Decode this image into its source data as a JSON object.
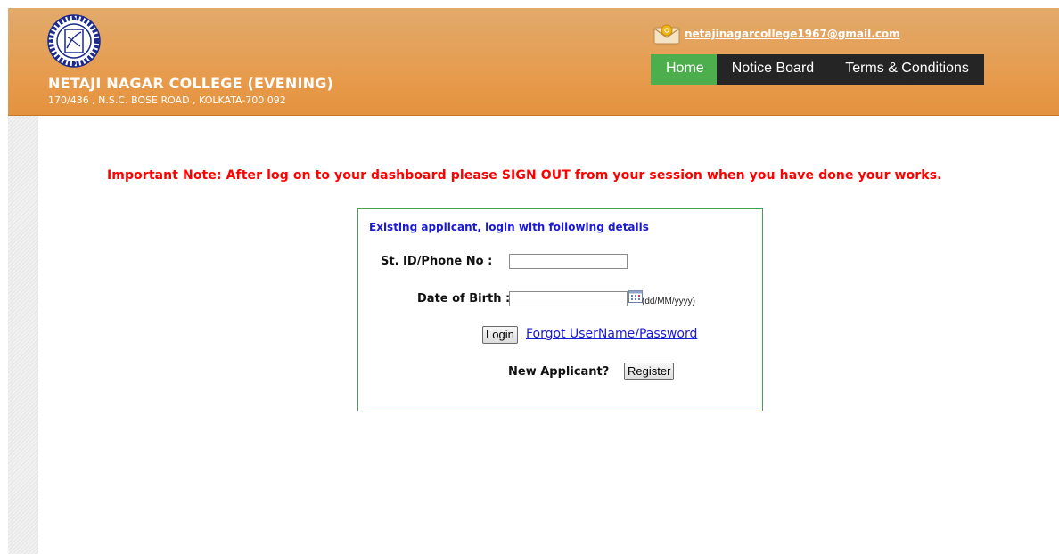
{
  "header": {
    "college_name": "NETAJI NAGAR COLLEGE (EVENING)",
    "address": "170/436 , N.S.C. BOSE ROAD , KOLKATA-700 092",
    "email": "netajinagarcollege1967@gmail.com",
    "logo_icon": "college-seal-logo",
    "mail_icon": "envelope-icon"
  },
  "nav": {
    "items": [
      {
        "label": "Home",
        "active": true
      },
      {
        "label": "Notice Board",
        "active": false
      },
      {
        "label": "Terms & Conditions",
        "active": false
      }
    ]
  },
  "main": {
    "important_note": "Important Note: After log on to your dashboard please SIGN OUT from your session when you have done your works."
  },
  "login": {
    "heading": "Existing applicant, login with following details",
    "id_label": "St. ID/Phone No :",
    "id_value": "",
    "dob_label": "Date of Birth :",
    "dob_value": "",
    "dob_format": "(dd/MM/yyyy)",
    "calendar_icon": "calendar-icon",
    "login_button": "Login",
    "forgot_link": "Forgot UserName/Password",
    "new_applicant_label": "New Applicant?",
    "register_button": "Register"
  },
  "colors": {
    "header_orange": "#e79a4a",
    "nav_active": "#4cae4c",
    "nav_dark": "#252525",
    "note_red": "#ff0000",
    "box_border": "#3ea34a",
    "link_blue": "#1a1ad4"
  }
}
